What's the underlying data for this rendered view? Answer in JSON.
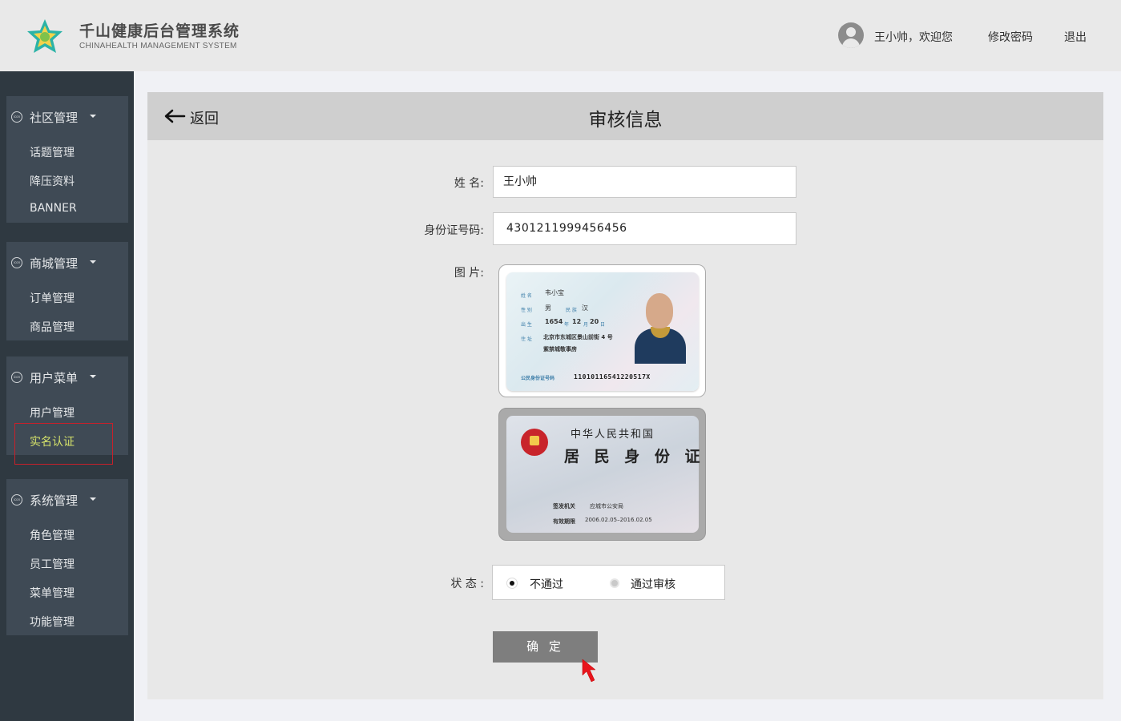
{
  "header": {
    "app_title": "千山健康后台管理系统",
    "app_subtitle": "CHINAHEALTH  MANAGEMENT SYSTEM",
    "welcome": "王小帅，欢迎您",
    "change_password": "修改密码",
    "logout": "退出",
    "logo_color": "#2bb3a7"
  },
  "sidebar": {
    "icon_text": "icon",
    "groups": [
      {
        "label": "社区管理",
        "items": [
          "话题管理",
          "降压资料",
          "BANNER"
        ]
      },
      {
        "label": "商城管理",
        "items": [
          "订单管理",
          "商品管理"
        ]
      },
      {
        "label": "用户菜单",
        "items": [
          "用户管理",
          "实名认证"
        ]
      },
      {
        "label": "系统管理",
        "items": [
          "角色管理",
          "员工管理",
          "菜单管理",
          "功能管理"
        ]
      }
    ],
    "active_item": "实名认证",
    "active_color": "#d6e36a"
  },
  "main": {
    "back_label": "返回",
    "title": "审核信息",
    "form": {
      "name_label": "姓 名:",
      "name_value": "王小帅",
      "id_label": "身份证号码:",
      "id_value": "4301211999456456",
      "image_label": "图 片:",
      "status_label": "状 态 :",
      "status_options": [
        "不通过",
        "通过审核"
      ],
      "status_selected": "不通过"
    },
    "confirm_label": "确 定",
    "id_card_front": {
      "name_key": "姓 名",
      "name": "韦小宝",
      "sex_key": "性 别",
      "sex": "男",
      "ethnic_key": "民 族",
      "ethnic": "汉",
      "birth_key": "出 生",
      "birth_year": "1654",
      "year_unit": "年",
      "birth_month": "12",
      "month_unit": "月",
      "birth_day": "20",
      "day_unit": "日",
      "address_key": "住 址",
      "address_line1": "北京市东城区景山前街 4 号",
      "address_line2": "紫禁城敬事房",
      "id_key": "公民身份证号码",
      "id_number": "11010116541220517X"
    },
    "id_card_back": {
      "title_line1": "中华人民共和国",
      "title_line2": "居 民 身 份 证",
      "authority_key": "签发机关",
      "authority": "应城市公安局",
      "validity_key": "有效期限",
      "validity": "2006.02.05–2016.02.05"
    }
  }
}
